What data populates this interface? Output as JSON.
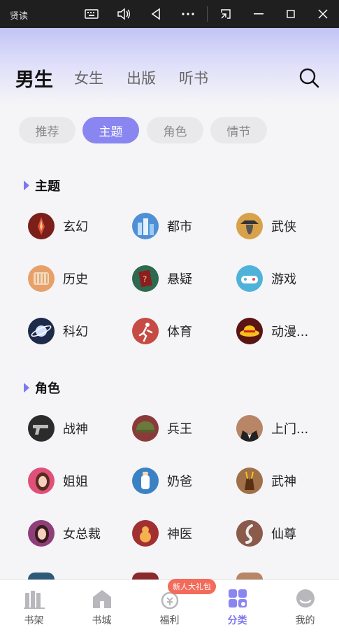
{
  "window": {
    "title": "贤读"
  },
  "header": {
    "tabs": [
      {
        "label": "男生",
        "active": true
      },
      {
        "label": "女生",
        "active": false
      },
      {
        "label": "出版",
        "active": false
      },
      {
        "label": "听书",
        "active": false
      }
    ],
    "search_icon": "search-icon"
  },
  "chips": [
    {
      "label": "推荐",
      "active": false
    },
    {
      "label": "主题",
      "active": true
    },
    {
      "label": "角色",
      "active": false
    },
    {
      "label": "情节",
      "active": false
    }
  ],
  "sections": [
    {
      "title": "主题",
      "items": [
        {
          "label": "玄幻",
          "color": "#7a1f1a"
        },
        {
          "label": "都市",
          "color": "#4f8fd6"
        },
        {
          "label": "武侠",
          "color": "#d8a24a"
        },
        {
          "label": "历史",
          "color": "#e8a06a"
        },
        {
          "label": "悬疑",
          "color": "#2d6a4f"
        },
        {
          "label": "游戏",
          "color": "#4fb3d9"
        },
        {
          "label": "科幻",
          "color": "#1d2a4a"
        },
        {
          "label": "体育",
          "color": "#c54b44"
        },
        {
          "label": "动漫...",
          "color": "#5a1414"
        }
      ]
    },
    {
      "title": "角色",
      "items": [
        {
          "label": "战神",
          "color": "#2b2b2b"
        },
        {
          "label": "兵王",
          "color": "#8b3a3a"
        },
        {
          "label": "上门...",
          "color": "#b88566"
        },
        {
          "label": "姐姐",
          "color": "#e0507a"
        },
        {
          "label": "奶爸",
          "color": "#3b82c4"
        },
        {
          "label": "武神",
          "color": "#a07048"
        },
        {
          "label": "女总裁",
          "color": "#8e3f7a"
        },
        {
          "label": "神医",
          "color": "#a23030"
        },
        {
          "label": "仙尊",
          "color": "#8a5a4a"
        }
      ]
    }
  ],
  "bottom_nav": [
    {
      "label": "书架",
      "icon": "bookshelf-icon",
      "active": false
    },
    {
      "label": "书城",
      "icon": "store-icon",
      "active": false
    },
    {
      "label": "福利",
      "icon": "welfare-icon",
      "active": false
    },
    {
      "label": "分类",
      "icon": "category-icon",
      "active": true
    },
    {
      "label": "我的",
      "icon": "profile-icon",
      "active": false
    }
  ],
  "welfare_badge": "新人大礼包",
  "accent_color": "#7b76ee"
}
